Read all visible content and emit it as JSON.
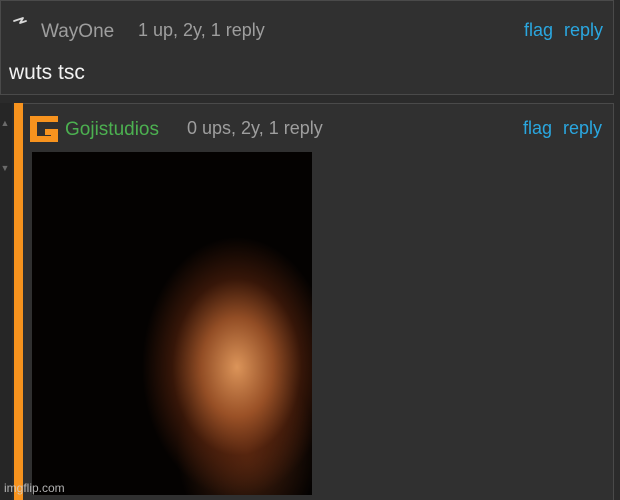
{
  "colors": {
    "orange": "#f7931e",
    "link": "#2aa7e0",
    "green_user": "#4cb050"
  },
  "comment1": {
    "avatar_icon": "slash-icon",
    "username": "WayOne",
    "meta": "1 up, 2y, 1 reply",
    "flag": "flag",
    "reply": "reply",
    "text": "wuts tsc"
  },
  "comment2": {
    "avatar_icon": "g-logo-icon",
    "username": "Gojistudios",
    "meta": "0 ups, 2y, 1 reply",
    "flag": "flag",
    "reply": "reply",
    "image_icon": "photo-icon",
    "watermark": "imgflip.com"
  }
}
